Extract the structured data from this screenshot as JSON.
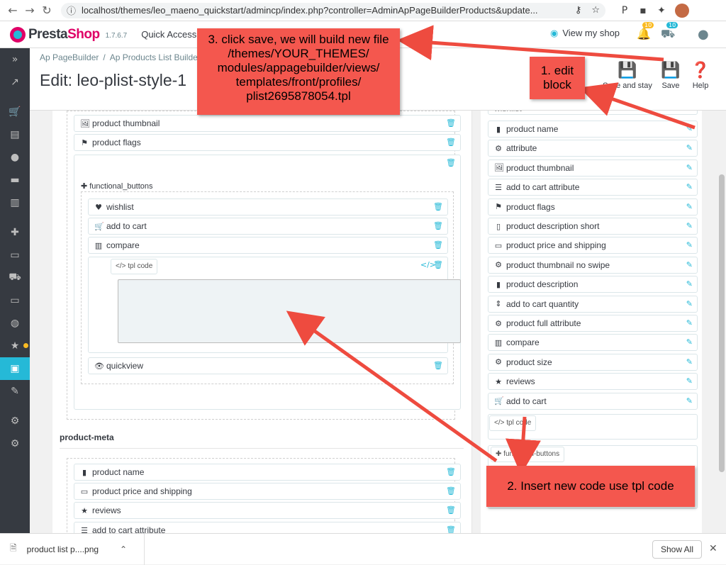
{
  "browser": {
    "url": "localhost/themes/leo_maeno_quickstart/admincp/index.php?controller=AdminApPageBuilderProducts&update...",
    "back": "←",
    "forward": "→",
    "reload": "↻",
    "ext_icons": [
      "⚷",
      "☆",
      "P",
      "▪",
      "✦"
    ]
  },
  "topbar": {
    "brand_a": "Presta",
    "brand_b": "Shop",
    "version": "1.7.6.7",
    "quick_access": "Quick Access",
    "view_shop": "View my shop",
    "orders_badge": "10",
    "customers_badge": "10"
  },
  "header": {
    "breadcrumb": [
      "Ap PageBuilder",
      "Ap Products List Builder"
    ],
    "title": "Edit: leo-plist-style-1",
    "save_stay": "Save and stay",
    "save": "Save",
    "help": "Help"
  },
  "left": {
    "top_items": [
      {
        "label": "product thumbnail",
        "icon": "🖼"
      },
      {
        "label": "product flags",
        "icon": "⚑"
      }
    ],
    "group_label": "functional_buttons",
    "group_items": [
      {
        "label": "wishlist",
        "icon": "♥"
      },
      {
        "label": "add to cart",
        "icon": "🛒"
      },
      {
        "label": "compare",
        "icon": "▥"
      }
    ],
    "tpl_label": "</> tpl code",
    "quickview": {
      "label": "quickview",
      "icon": "👁"
    },
    "meta_title": "product-meta",
    "meta_items": [
      {
        "label": "product name",
        "icon": "▮"
      },
      {
        "label": "product price and shipping",
        "icon": "▭"
      },
      {
        "label": "reviews",
        "icon": "★"
      },
      {
        "label": "add to cart attribute",
        "icon": "☰"
      }
    ]
  },
  "right": {
    "cut_item": "wishlist",
    "items": [
      {
        "label": "product name",
        "icon": "▮"
      },
      {
        "label": "attribute",
        "icon": "⚙"
      },
      {
        "label": "product thumbnail",
        "icon": "🖼"
      },
      {
        "label": "add to cart attribute",
        "icon": "☰"
      },
      {
        "label": "product flags",
        "icon": "⚑"
      },
      {
        "label": "product description short",
        "icon": "▯"
      },
      {
        "label": "product price and shipping",
        "icon": "▭"
      },
      {
        "label": "product thumbnail no swipe",
        "icon": "⚙"
      },
      {
        "label": "product description",
        "icon": "▮"
      },
      {
        "label": "add to cart quantity",
        "icon": "⇕"
      },
      {
        "label": "product full attribute",
        "icon": "⚙"
      },
      {
        "label": "compare",
        "icon": "▥"
      },
      {
        "label": "product size",
        "icon": "⚙"
      },
      {
        "label": "reviews",
        "icon": "★"
      },
      {
        "label": "add to cart",
        "icon": "🛒"
      }
    ],
    "tpl_label": "</> tpl code",
    "func_label": "functional-buttons"
  },
  "callouts": {
    "step1": "1. edit\nblock",
    "step2": "2. Insert new code use tpl code",
    "step3": "3. click save, we will build new file /themes/YOUR_THEMES/ modules/appagebuilder/views/ templates/front/profiles/ plist2695878054.tpl"
  },
  "downloads": {
    "file": "product list p....png",
    "show_all": "Show All"
  },
  "colors": {
    "accent": "#25b9d7",
    "brand": "#df0067",
    "callout": "#f4574e",
    "arrow": "#ee4b3f"
  }
}
